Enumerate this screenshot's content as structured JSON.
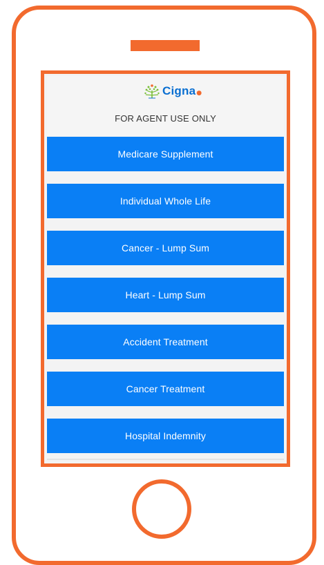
{
  "brand": {
    "name": "Cigna",
    "logo_icon": "tree-logo-icon",
    "primary_color": "#0a7ff5",
    "accent_color": "#f26a2e"
  },
  "header": {
    "notice": "FOR AGENT USE ONLY"
  },
  "menu": {
    "items": [
      {
        "label": "Medicare Supplement"
      },
      {
        "label": "Individual Whole Life"
      },
      {
        "label": "Cancer - Lump Sum"
      },
      {
        "label": "Heart - Lump Sum"
      },
      {
        "label": "Accident Treatment"
      },
      {
        "label": "Cancer Treatment"
      },
      {
        "label": "Hospital Indemnity"
      }
    ]
  }
}
